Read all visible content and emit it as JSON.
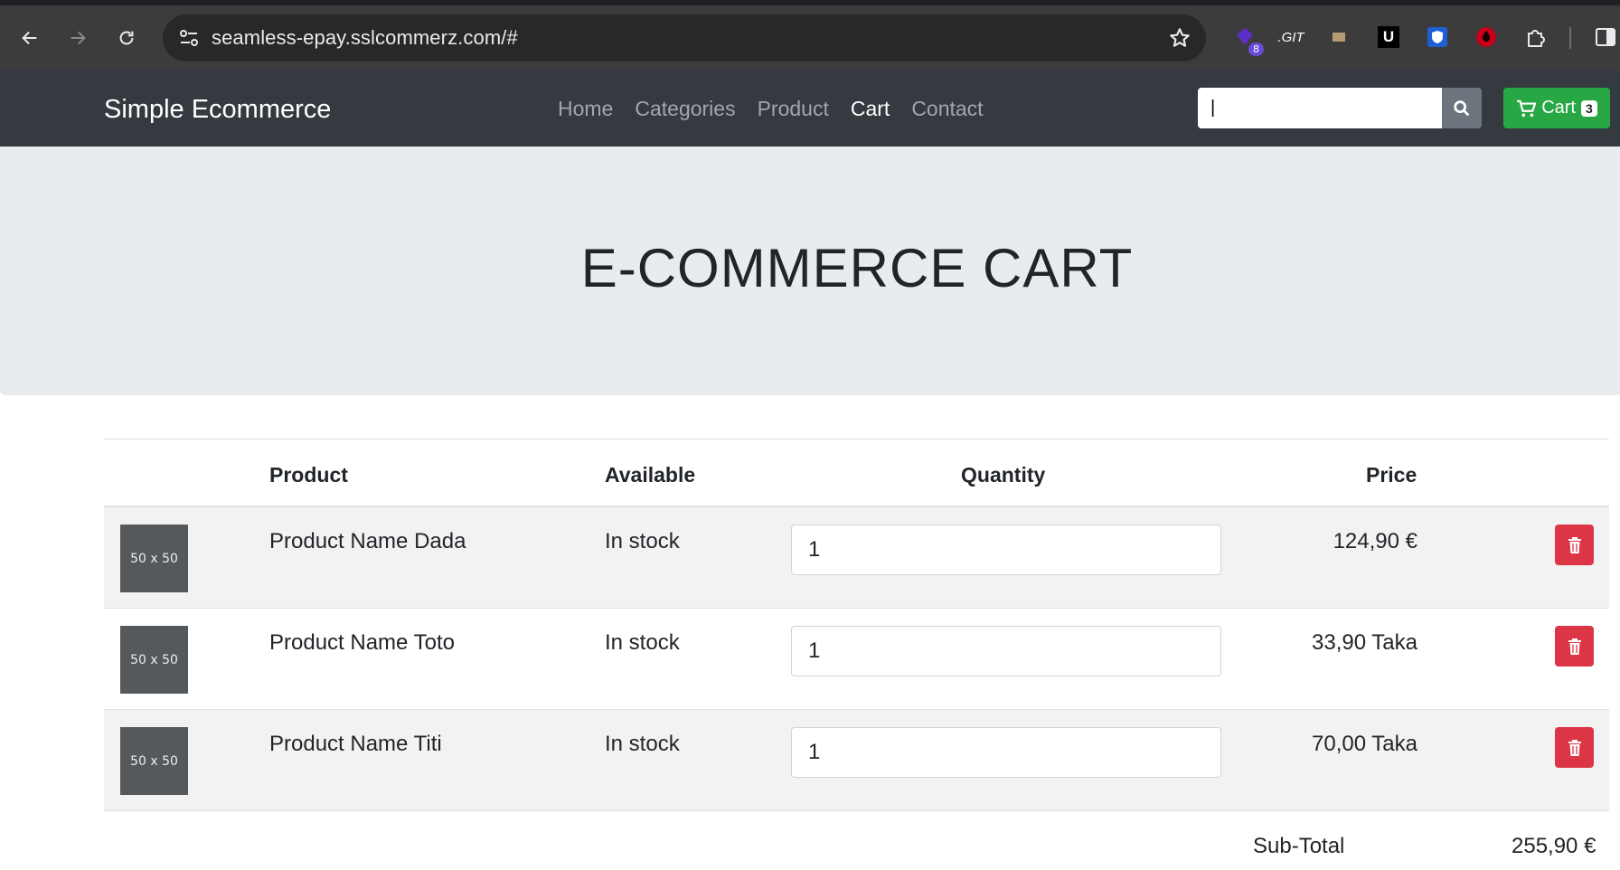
{
  "browser": {
    "url": "seamless-epay.sslcommerz.com/#",
    "extensions": [
      {
        "icon": "purple-extension-icon",
        "badge": "8"
      },
      {
        "icon": "git-extension-icon",
        "label": ".GIT"
      },
      {
        "icon": "tan-extension-icon"
      },
      {
        "icon": "u-extension-icon",
        "label": "U"
      },
      {
        "icon": "shield-extension-icon"
      },
      {
        "icon": "red-drop-extension-icon"
      },
      {
        "icon": "puzzle-icon"
      },
      {
        "icon": "sidebar-icon"
      }
    ]
  },
  "navbar": {
    "brand": "Simple Ecommerce",
    "links": [
      "Home",
      "Categories",
      "Product",
      "Cart",
      "Contact"
    ],
    "active_link": "Cart",
    "search_value": "|",
    "cart_label": "Cart",
    "cart_count": "3",
    "colors": {
      "bg": "#343a40",
      "cart_green": "#28a745",
      "search_grey": "#6c757d"
    }
  },
  "jumbotron": {
    "title": "E-COMMERCE CART"
  },
  "table": {
    "headers": {
      "product": "Product",
      "available": "Available",
      "quantity": "Quantity",
      "price": "Price"
    },
    "rows": [
      {
        "thumb": "50 x 50",
        "name": "Product Name Dada",
        "available": "In stock",
        "quantity": "1",
        "price": "124,90 €"
      },
      {
        "thumb": "50 x 50",
        "name": "Product Name Toto",
        "available": "In stock",
        "quantity": "1",
        "price": "33,90 Taka"
      },
      {
        "thumb": "50 x 50",
        "name": "Product Name Titi",
        "available": "In stock",
        "quantity": "1",
        "price": "70,00 Taka"
      }
    ],
    "delete_color": "#dc3545"
  },
  "summary": {
    "subtotal_label": "Sub-Total",
    "subtotal_value": "255,90 €"
  }
}
